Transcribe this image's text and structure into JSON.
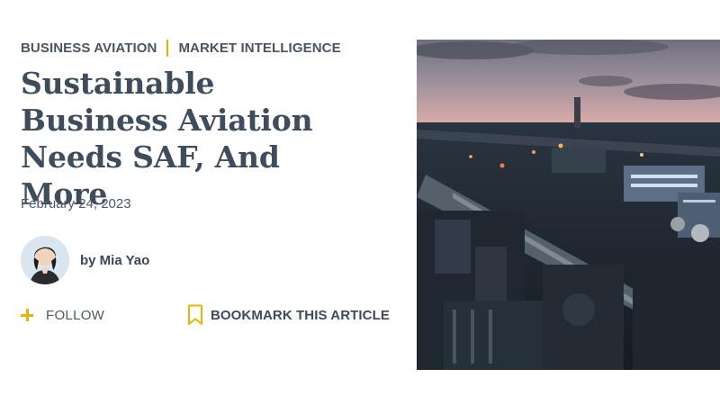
{
  "kicker": {
    "category_1": "BUSINESS AVIATION",
    "category_2": "MARKET INTELLIGENCE"
  },
  "article": {
    "headline": "Sustainable Business Aviation Needs SAF, And More",
    "date": "February 24, 2023",
    "author": "by Mia Yao"
  },
  "actions": {
    "follow_label": "FOLLOW",
    "bookmark_label": "BOOKMARK THIS ARTICLE"
  },
  "colors": {
    "accent": "#e3b505",
    "heading": "#3e4c5c",
    "text": "#4e5864"
  },
  "icons": {
    "follow": "plus-icon",
    "bookmark": "bookmark-icon"
  },
  "image": {
    "subject": "industrial refinery at dusk"
  }
}
